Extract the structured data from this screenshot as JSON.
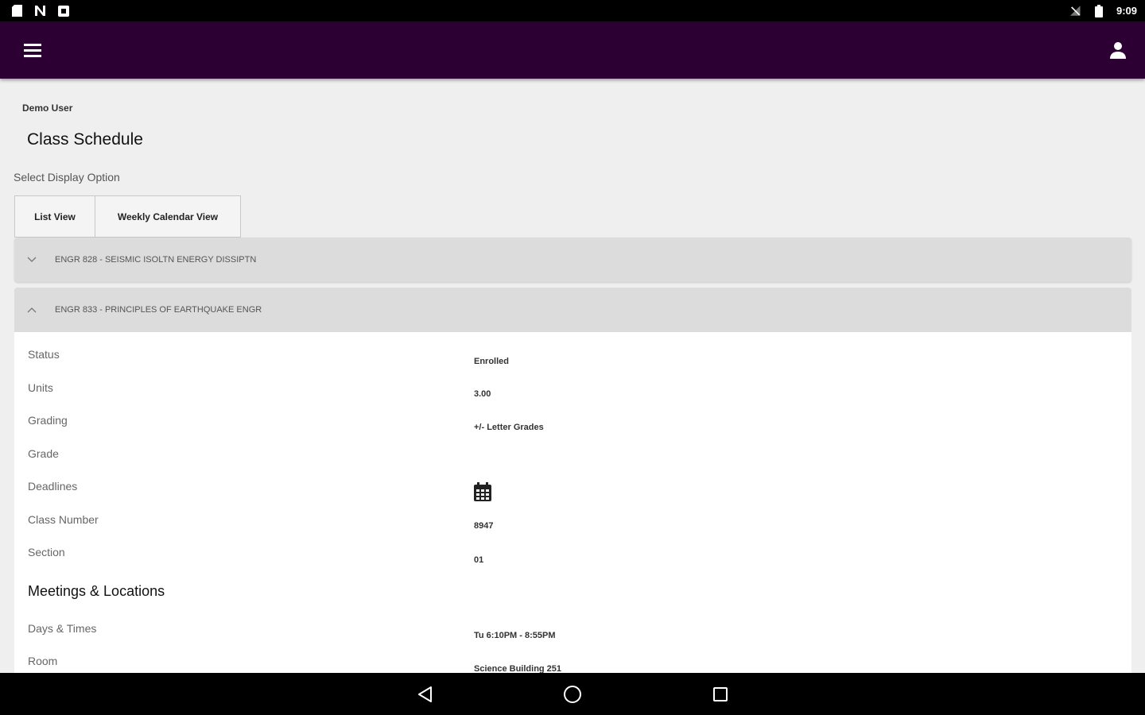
{
  "status_bar": {
    "time": "9:09",
    "left_icons": [
      "sd-card-icon",
      "n-icon",
      "notification-icon"
    ],
    "right_icons": [
      "signal-off-icon",
      "battery-icon"
    ]
  },
  "app_bar": {
    "menu_icon": "menu-icon",
    "account_icon": "account-icon",
    "color": "#2c0033"
  },
  "page": {
    "user_name": "Demo User",
    "title": "Class Schedule",
    "display_option_label": "Select Display Option",
    "view_options": {
      "list": "List View",
      "weekly": "Weekly Calendar View"
    }
  },
  "courses": [
    {
      "title": "ENGR 828 - SEISMIC ISOLTN ENERGY DISSIPTN",
      "expanded": false
    },
    {
      "title": "ENGR 833 - PRINCIPLES OF EARTHQUAKE ENGR",
      "expanded": true
    }
  ],
  "details": {
    "status": {
      "label": "Status",
      "value": "Enrolled"
    },
    "units": {
      "label": "Units",
      "value": "3.00"
    },
    "grading": {
      "label": "Grading",
      "value": "+/- Letter Grades"
    },
    "grade": {
      "label": "Grade",
      "value": ""
    },
    "deadlines": {
      "label": "Deadlines",
      "icon": "calendar-icon"
    },
    "class_number": {
      "label": "Class Number",
      "value": "8947"
    },
    "section": {
      "label": "Section",
      "value": "01"
    }
  },
  "meetings": {
    "heading": "Meetings & Locations",
    "days_times": {
      "label": "Days & Times",
      "value": "Tu 6:10PM - 8:55PM"
    },
    "room": {
      "label": "Room",
      "value": "Science Building 251"
    }
  },
  "nav_bar": {
    "buttons": [
      "back-icon",
      "home-icon",
      "recents-icon"
    ]
  }
}
